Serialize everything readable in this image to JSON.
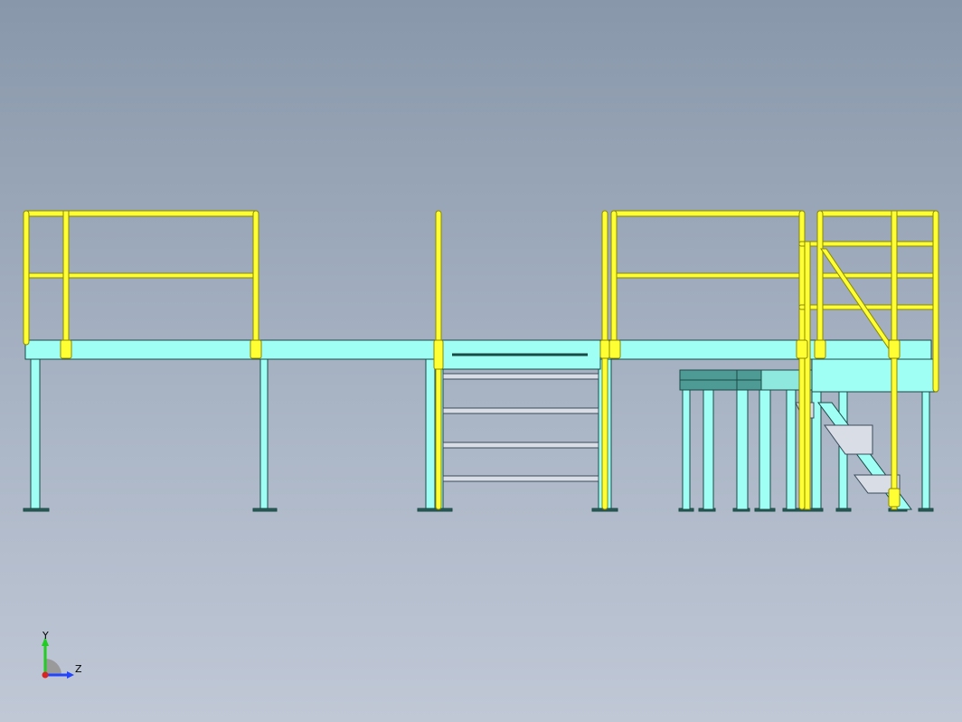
{
  "view": {
    "background_top": "#8897aa",
    "background_bottom": "#c0c8d6"
  },
  "colors": {
    "railing": "#ffff33",
    "railing_edge": "#8a8a00",
    "structure": "#9ffff5",
    "structure_edge": "#1a4a46",
    "bench_top": "#4e9b96",
    "bench_front": "#8fe8dd",
    "tread": "#d8dde6"
  },
  "triad": {
    "y_label": "Y",
    "z_label": "Z",
    "y_color": "#22cc22",
    "z_color": "#2244ff",
    "origin_color": "#dd2222"
  }
}
